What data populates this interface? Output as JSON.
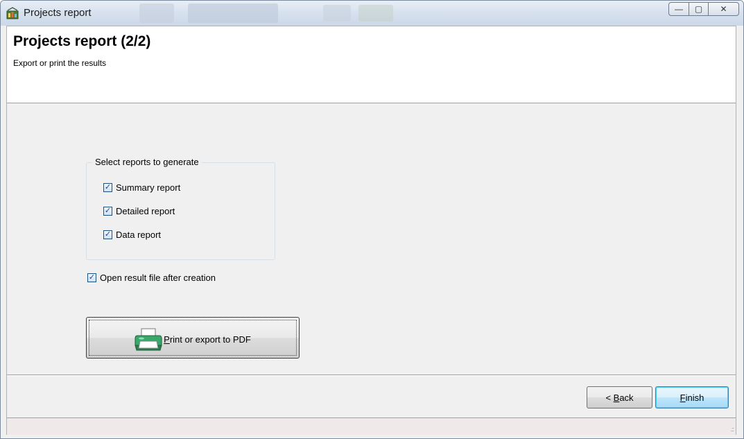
{
  "window": {
    "title": "Projects report",
    "minimize_glyph": "—",
    "maximize_glyph": "▢",
    "close_glyph": "✕"
  },
  "header": {
    "title": "Projects report (2/2)",
    "subtitle": "Export or print the results"
  },
  "reports_group": {
    "legend": "Select reports to generate",
    "items": [
      {
        "label": "Summary report",
        "checked": true
      },
      {
        "label": "Detailed report",
        "checked": true
      },
      {
        "label": "Data report",
        "checked": true
      }
    ]
  },
  "open_after": {
    "label": "Open result file after creation",
    "checked": true
  },
  "print_button": {
    "accel": "P",
    "rest": "rint or export to PDF",
    "icon": "printer-icon"
  },
  "nav": {
    "back_prefix": "< ",
    "back_accel": "B",
    "back_rest": "ack",
    "finish_accel": "F",
    "finish_rest": "inish"
  },
  "check_glyph": "✓",
  "grip_glyph": ".::"
}
